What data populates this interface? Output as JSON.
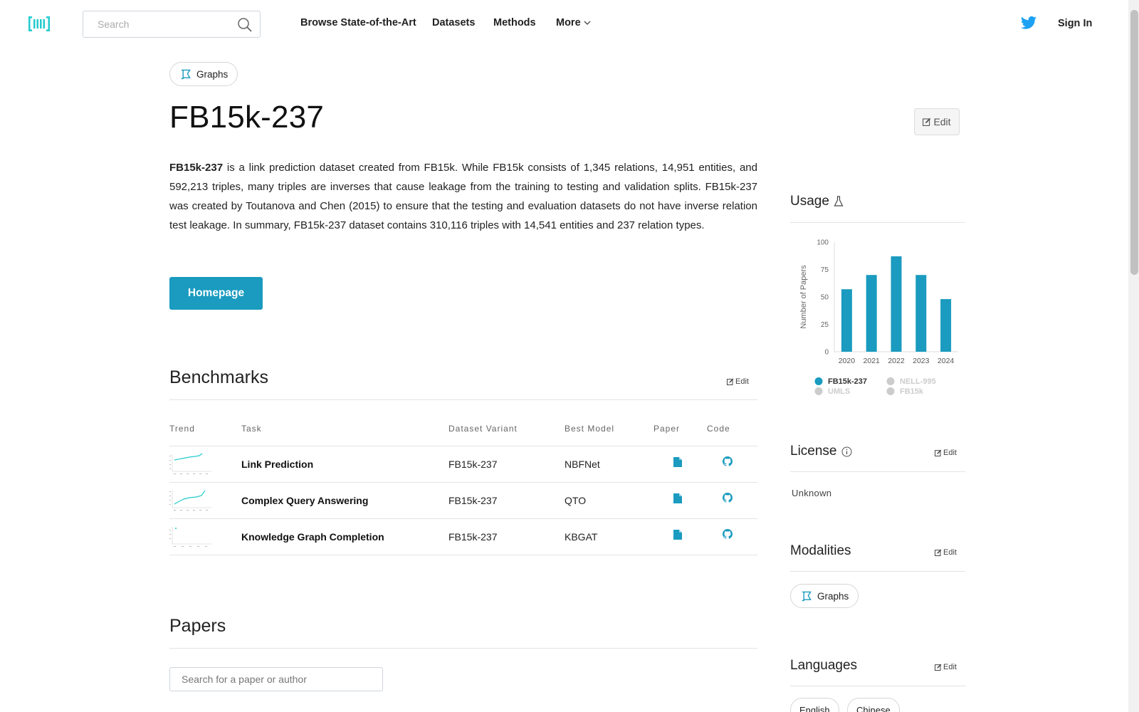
{
  "nav": {
    "search_placeholder": "Search",
    "links": [
      "Browse State-of-the-Art",
      "Datasets",
      "Methods",
      "More"
    ],
    "sign_in": "Sign In"
  },
  "dataset": {
    "modality_tag": "Graphs",
    "title": "FB15k-237",
    "edit_label": "Edit",
    "description_lead": "FB15k-237",
    "description_rest": " is a link prediction dataset created from FB15k. While FB15k consists of 1,345 relations, 14,951 entities, and 592,213 triples, many triples are inverses that cause leakage from the training to testing and validation splits. FB15k-237 was created by Toutanova and Chen (2015) to ensure that the testing and evaluation datasets do not have inverse relation test leakage. In summary, FB15k-237 dataset contains 310,116 triples with 14,541 entities and 237 relation types.",
    "homepage_label": "Homepage"
  },
  "benchmarks": {
    "title": "Benchmarks",
    "edit_label": "Edit",
    "columns": [
      "Trend",
      "Task",
      "Dataset Variant",
      "Best Model",
      "Paper",
      "Code"
    ],
    "rows": [
      {
        "task": "Link Prediction",
        "variant": "FB15k-237",
        "model": "NBFNet"
      },
      {
        "task": "Complex Query Answering",
        "variant": "FB15k-237",
        "model": "QTO"
      },
      {
        "task": "Knowledge Graph Completion",
        "variant": "FB15k-237",
        "model": "KBGAT"
      }
    ]
  },
  "papers": {
    "title": "Papers",
    "search_placeholder": "Search for a paper or author"
  },
  "sidebar": {
    "usage_title": "Usage",
    "license_title": "License",
    "license_value": "Unknown",
    "modalities_title": "Modalities",
    "modality_item": "Graphs",
    "languages_title": "Languages",
    "languages": [
      "English",
      "Chinese"
    ],
    "edit_label": "Edit"
  },
  "chart_data": {
    "type": "bar",
    "categories": [
      "2020",
      "2021",
      "2022",
      "2023",
      "2024"
    ],
    "values": [
      57,
      70,
      87,
      70,
      48
    ],
    "ylabel": "Number of Papers",
    "ylim": [
      0,
      100
    ],
    "yticks": [
      "0",
      "25",
      "50",
      "75",
      "100"
    ],
    "legend": [
      {
        "name": "FB15k-237",
        "active": true
      },
      {
        "name": "NELL-995",
        "active": false
      },
      {
        "name": "UMLS",
        "active": false
      },
      {
        "name": "FB15k",
        "active": false
      }
    ],
    "legend_position": "bottom",
    "bar_color": "#1a9bbf",
    "inactive_color": "#cccccc"
  },
  "colors": {
    "accent": "#1a9bbf",
    "twitter": "#1da1f2",
    "logo": "#21cbce"
  }
}
